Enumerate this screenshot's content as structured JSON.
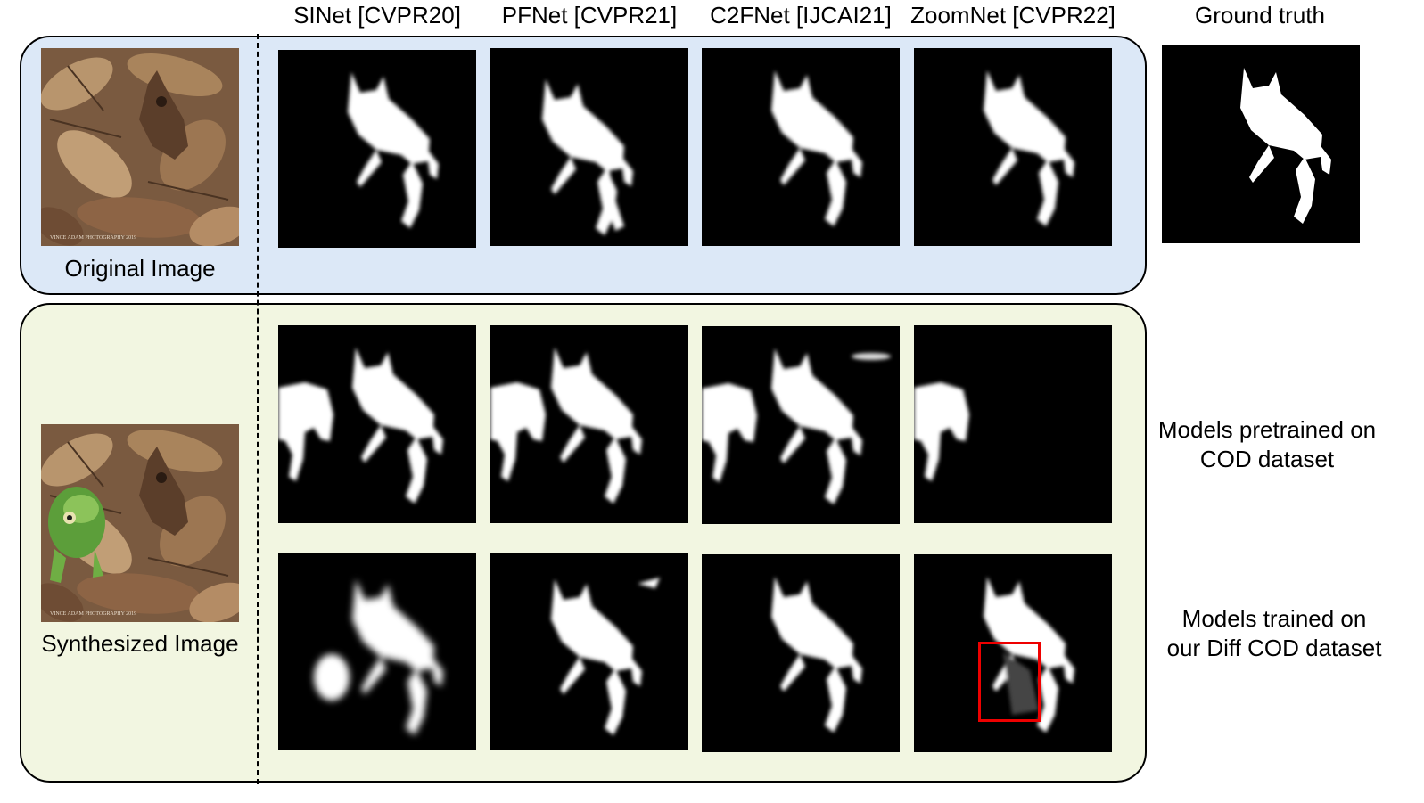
{
  "column_headers": {
    "sinet": "SINet [CVPR20]",
    "pfnet": "PFNet [CVPR21]",
    "c2fnet": "C2FNet [IJCAI21]",
    "zoomnet": "ZoomNet [CVPR22]",
    "ground_truth": "Ground truth"
  },
  "captions": {
    "original": "Original Image",
    "synthesized": "Synthesized Image"
  },
  "row_notes": {
    "pretrained_line1": "Models pretrained on",
    "pretrained_line2": "COD dataset",
    "trained_line1": "Models trained on",
    "trained_line2": "our Diff COD dataset"
  },
  "colors": {
    "top_panel_bg": "#dce8f7",
    "bottom_panel_bg": "#f2f6e1",
    "highlight_box": "#e00000",
    "mask_fg": "#ffffff",
    "mask_bg": "#000000"
  },
  "photo_watermark": "VINCE ADAM PHOTOGRAPHY 2019"
}
